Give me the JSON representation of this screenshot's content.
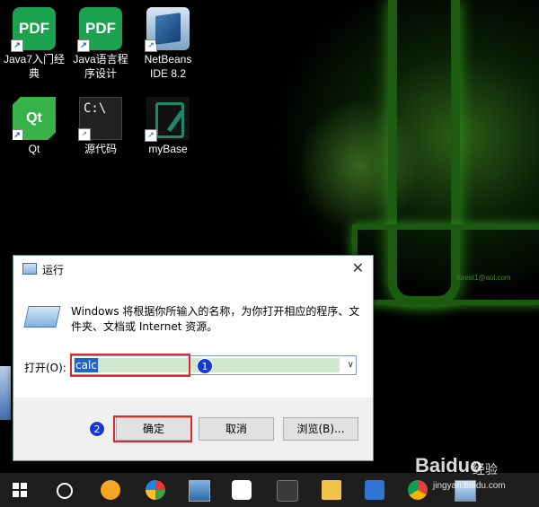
{
  "desktop_icons": [
    {
      "label_line1": "Java7入门经",
      "label_line2": "典",
      "tile_text": "PDF",
      "icon": "pdf-icon"
    },
    {
      "label_line1": "Java语言程",
      "label_line2": "序设计",
      "tile_text": "PDF",
      "icon": "pdf-icon"
    },
    {
      "label_line1": "NetBeans",
      "label_line2": "IDE 8.2",
      "tile_text": "",
      "icon": "netbeans-icon"
    },
    {
      "label_line1": "Qt",
      "label_line2": "",
      "tile_text": "Qt",
      "icon": "qt-icon"
    },
    {
      "label_line1": "源代码",
      "label_line2": "",
      "tile_text": "C:\\",
      "icon": "cmd-icon"
    },
    {
      "label_line1": "myBase",
      "label_line2": "",
      "tile_text": "",
      "icon": "mybase-icon"
    }
  ],
  "shortcut_arrow": "↗",
  "wallpaper": {
    "watermark": "forest1@aol.com"
  },
  "run_dialog": {
    "title": "运行",
    "close_glyph": "✕",
    "description": "Windows 将根据你所输入的名称，为你打开相应的程序、文件夹、文档或 Internet 资源。",
    "open_label": "打开(O):",
    "open_value": "calc",
    "dropdown_glyph": "∨",
    "ok_label": "确定",
    "cancel_label": "取消",
    "browse_label": "浏览(B)..."
  },
  "annotations": {
    "badge1": "1",
    "badge2": "2",
    "highlight_color": "#e0282e",
    "badge_color": "#1638d8"
  },
  "taskbar": {
    "items": [
      "start-button",
      "cortana",
      "wifi-app",
      "game-app",
      "monitor-app",
      "wps-app",
      "terminal-app",
      "file-explorer",
      "translator-app",
      "chrome",
      "run-app"
    ]
  },
  "watermark": {
    "brand": "Baiduo",
    "suffix": "经验",
    "url": "jingyan.baidu.com"
  }
}
